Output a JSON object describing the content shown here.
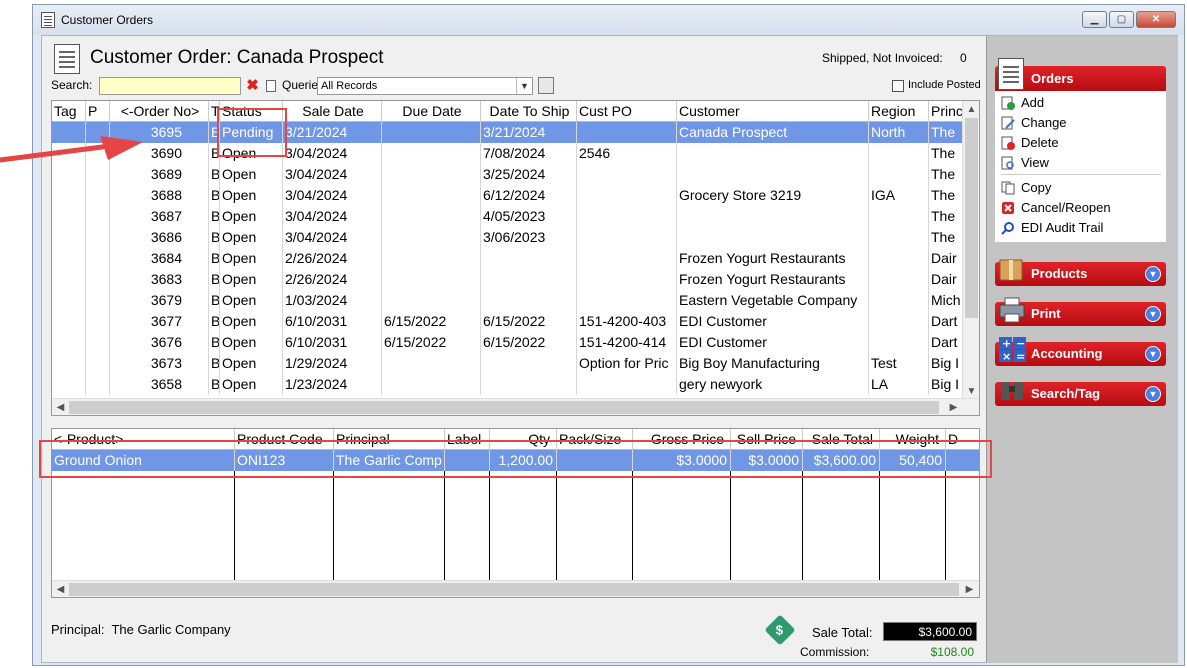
{
  "window": {
    "title": "Customer Orders"
  },
  "header": {
    "title": "Customer Order: Canada Prospect",
    "shipped_label": "Shipped, Not Invoiced:",
    "shipped_value": "0"
  },
  "search": {
    "label": "Search:",
    "value": "",
    "queries_label": "Queries:",
    "queries_value": "All Records",
    "include_posted": "Include Posted"
  },
  "orders_table": {
    "columns": [
      "Tag",
      "P",
      "<-Order No>",
      "T",
      "Status",
      "Sale Date",
      "Due Date",
      "Date To Ship",
      "Cust PO",
      "Customer",
      "Region",
      "Princ"
    ],
    "rows": [
      {
        "order": "3695",
        "t": "E",
        "status": "Pending",
        "sale": "3/21/2024",
        "due": "",
        "ship": "3/21/2024",
        "po": "",
        "customer": "Canada Prospect",
        "region": "North",
        "princ": "The"
      },
      {
        "order": "3690",
        "t": "B",
        "status": "Open",
        "sale": "3/04/2024",
        "due": "",
        "ship": "7/08/2024",
        "po": "2546",
        "customer": "",
        "region": "",
        "princ": "The"
      },
      {
        "order": "3689",
        "t": "B",
        "status": "Open",
        "sale": "3/04/2024",
        "due": "",
        "ship": "3/25/2024",
        "po": "",
        "customer": "",
        "region": "",
        "princ": "The"
      },
      {
        "order": "3688",
        "t": "B",
        "status": "Open",
        "sale": "3/04/2024",
        "due": "",
        "ship": "6/12/2024",
        "po": "",
        "customer": "Grocery Store 3219",
        "region": "IGA",
        "princ": "The"
      },
      {
        "order": "3687",
        "t": "B",
        "status": "Open",
        "sale": "3/04/2024",
        "due": "",
        "ship": "4/05/2023",
        "po": "",
        "customer": "",
        "region": "",
        "princ": "The"
      },
      {
        "order": "3686",
        "t": "B",
        "status": "Open",
        "sale": "3/04/2024",
        "due": "",
        "ship": "3/06/2023",
        "po": "",
        "customer": "",
        "region": "",
        "princ": "The"
      },
      {
        "order": "3684",
        "t": "B",
        "status": "Open",
        "sale": "2/26/2024",
        "due": "",
        "ship": "",
        "po": "",
        "customer": "Frozen Yogurt Restaurants",
        "region": "",
        "princ": "Dair"
      },
      {
        "order": "3683",
        "t": "B",
        "status": "Open",
        "sale": "2/26/2024",
        "due": "",
        "ship": "",
        "po": "",
        "customer": "Frozen Yogurt Restaurants",
        "region": "",
        "princ": "Dair"
      },
      {
        "order": "3679",
        "t": "B",
        "status": "Open",
        "sale": "1/03/2024",
        "due": "",
        "ship": "",
        "po": "",
        "customer": "Eastern Vegetable Company",
        "region": "",
        "princ": "Mich"
      },
      {
        "order": "3677",
        "t": "B",
        "status": "Open",
        "sale": "6/10/2031",
        "due": "6/15/2022",
        "ship": "6/15/2022",
        "po": "151-4200-403",
        "customer": "EDI Customer",
        "region": "",
        "princ": "Dart"
      },
      {
        "order": "3676",
        "t": "B",
        "status": "Open",
        "sale": "6/10/2031",
        "due": "6/15/2022",
        "ship": "6/15/2022",
        "po": "151-4200-414",
        "customer": "EDI Customer",
        "region": "",
        "princ": "Dart"
      },
      {
        "order": "3673",
        "t": "B",
        "status": "Open",
        "sale": "1/29/2024",
        "due": "",
        "ship": "",
        "po": "Option for Pric",
        "customer": "Big Boy Manufacturing",
        "region": "Test",
        "princ": "Big I"
      },
      {
        "order": "3658",
        "t": "B",
        "status": "Open",
        "sale": "1/23/2024",
        "due": "",
        "ship": "",
        "po": "",
        "customer": "gery newyork",
        "region": "LA",
        "princ": "Big I"
      }
    ]
  },
  "products_table": {
    "columns": [
      "<-Product>",
      "Product Code",
      "Principal",
      "Label",
      "Qty",
      "Pack/Size",
      "Gross Price",
      "Sell Price",
      "Sale Total",
      "Weight",
      "D"
    ],
    "rows": [
      {
        "product": "Ground Onion",
        "code": "ONI123",
        "principal": "The Garlic Comp",
        "label": "",
        "qty": "1,200.00",
        "pack": "",
        "gross": "$3.0000",
        "sell": "$3.0000",
        "total": "$3,600.00",
        "weight": "50,400",
        "d": ""
      }
    ]
  },
  "footer": {
    "principal_label": "Principal:",
    "principal_value": "The Garlic Company",
    "sale_total_label": "Sale Total:",
    "sale_total_value": "$3,600.00",
    "commission_label": "Commission:",
    "commission_value": "$108.00"
  },
  "sidebar": {
    "orders_title": "Orders",
    "actions": [
      "Add",
      "Change",
      "Delete",
      "View",
      "Copy",
      "Cancel/Reopen",
      "EDI Audit Trail"
    ],
    "sections": [
      "Products",
      "Print",
      "Accounting",
      "Search/Tag"
    ]
  },
  "colors": {
    "selection": "#6f97e6",
    "accent_red": "#d81a20",
    "highlight_box": "#e64545"
  }
}
